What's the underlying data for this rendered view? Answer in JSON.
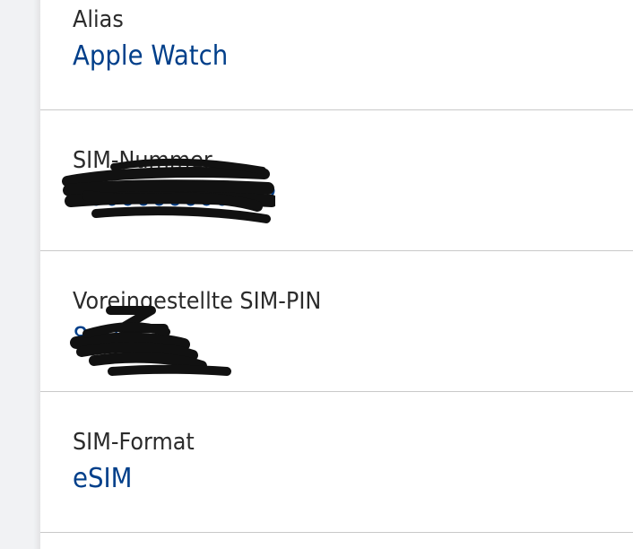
{
  "fields": [
    {
      "label": "Alias",
      "value": "Apple Watch"
    },
    {
      "label": "SIM-Nummer",
      "value": "0000000000022"
    },
    {
      "label": "Voreingestellte SIM-PIN",
      "value": "8..8"
    },
    {
      "label": "SIM-Format",
      "value": "eSIM"
    }
  ],
  "colors": {
    "label": "#2b2b2b",
    "value": "#003f8a",
    "divider": "#c9c9c9",
    "gutter": "#f1f2f4",
    "redaction": "#111111"
  }
}
